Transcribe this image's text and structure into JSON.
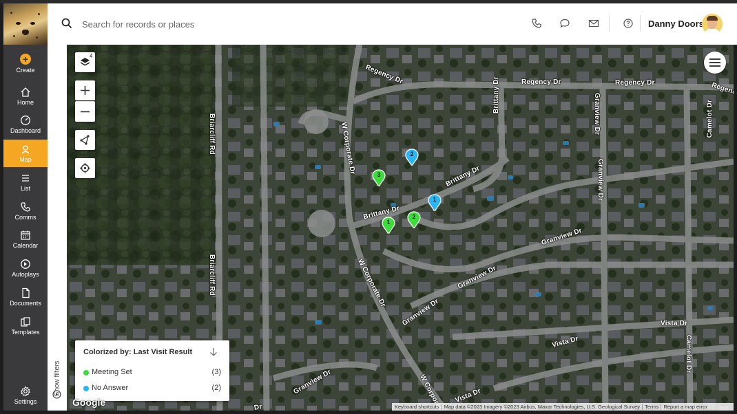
{
  "sidebar": {
    "create_label": "Create",
    "items": [
      {
        "label": "Home",
        "icon": "home-icon"
      },
      {
        "label": "Dashboard",
        "icon": "gauge-icon"
      },
      {
        "label": "Map",
        "icon": "map-pin-icon",
        "active": true
      },
      {
        "label": "List",
        "icon": "list-icon"
      },
      {
        "label": "Comms",
        "icon": "phone-icon"
      },
      {
        "label": "Calendar",
        "icon": "calendar-icon"
      },
      {
        "label": "Autoplays",
        "icon": "autoplay-icon"
      },
      {
        "label": "Documents",
        "icon": "document-icon"
      },
      {
        "label": "Templates",
        "icon": "templates-icon"
      }
    ],
    "settings_label": "Settings",
    "accent_color": "#f5a623"
  },
  "search": {
    "placeholder": "Search for records or places"
  },
  "user": {
    "name": "Danny Doors"
  },
  "filters": {
    "label": "Show filters"
  },
  "map": {
    "layer_count": "4",
    "streets": [
      "Regency Dr",
      "Regency Dr",
      "Regency Dr",
      "Regency Dr",
      "Brittany Dr",
      "Granview Dr",
      "Camelot Dr",
      "Briarcliff Rd",
      "W Corporate Dr",
      "Brittany Dr",
      "Brittany Dr",
      "Granview Dr",
      "Granview Dr",
      "Briarcliff Rd",
      "W Corporate Dr",
      "Granview Dr",
      "Granview Dr",
      "Vista Dr",
      "Camelot Dr",
      "Vista Dr",
      "W Corporate Dr",
      "Vista Dr",
      "Granview Dr",
      "Dr"
    ],
    "pins": [
      {
        "label": "2",
        "status": "No Answer"
      },
      {
        "label": "3",
        "status": "Meeting Set"
      },
      {
        "label": "1",
        "status": "No Answer"
      },
      {
        "label": "2",
        "status": "Meeting Set"
      },
      {
        "label": "1",
        "status": "Meeting Set"
      }
    ],
    "google_logo": "Google",
    "attribution": {
      "keyboard": "Keyboard shortcuts",
      "data": "Map data ©2023 Imagery ©2023 Airbus, Maxar Technologies, U.S. Geological Survey",
      "terms": "Terms",
      "report": "Report a map error"
    }
  },
  "legend": {
    "title": "Colorized by: Last Visit Result",
    "items": [
      {
        "label": "Meeting Set",
        "count": "(3)",
        "color": "#3ddc3d"
      },
      {
        "label": "No Answer",
        "count": "(2)",
        "color": "#29b6f6"
      }
    ]
  }
}
